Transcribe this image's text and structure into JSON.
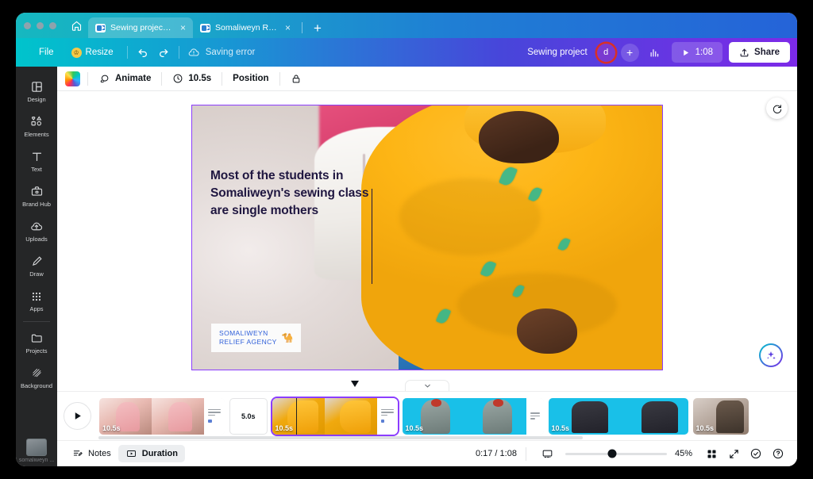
{
  "browser": {
    "home_icon": "home-icon",
    "tabs": [
      {
        "title": "Sewing project - Vi...",
        "favicon": "video-icon",
        "close": "×",
        "active": true
      },
      {
        "title": "Somaliweyn Relief ...",
        "favicon": "video-icon",
        "close": "×",
        "active": false
      }
    ],
    "new_tab_label": "+"
  },
  "toolbar": {
    "file_label": "File",
    "resize_label": "Resize",
    "crown_icon": "crown-icon",
    "undo_icon": "undo-icon",
    "redo_icon": "redo-icon",
    "saving_status": "Saving error",
    "cloud_alert_icon": "cloud-alert-icon",
    "project_name": "Sewing project",
    "avatar_initial": "d",
    "add_collaborator_label": "+",
    "insights_icon": "bar-chart-icon",
    "play_icon": "play-icon",
    "duration": "1:08",
    "share_label": "Share",
    "share_icon": "upload-icon"
  },
  "sidebar": {
    "items": [
      {
        "label": "Design",
        "icon": "layout-icon"
      },
      {
        "label": "Elements",
        "icon": "shapes-icon"
      },
      {
        "label": "Text",
        "icon": "text-icon"
      },
      {
        "label": "Brand Hub",
        "icon": "briefcase-icon"
      },
      {
        "label": "Uploads",
        "icon": "upload-cloud-icon"
      },
      {
        "label": "Draw",
        "icon": "pen-icon"
      },
      {
        "label": "Apps",
        "icon": "grid-dots-icon"
      }
    ],
    "bottom_items": [
      {
        "label": "Projects",
        "icon": "folder-icon"
      },
      {
        "label": "Background",
        "icon": "hatch-icon"
      }
    ],
    "thumbnail_label": "somaliweyn ..."
  },
  "context_toolbar": {
    "color_swatch": "rainbow-swatch",
    "animate_label": "Animate",
    "animate_icon": "animate-icon",
    "duration_value": "10.5s",
    "clock_icon": "clock-icon",
    "position_label": "Position",
    "lock_icon": "lock-icon"
  },
  "canvas": {
    "headline": "Most of the students in Somaliweyn's sewing class are single mothers",
    "logo": {
      "line1": "SOMALIWEYN",
      "line2": "RELIEF AGENCY",
      "icon": "camel-icon",
      "text_color": "#2f5fd9"
    },
    "rotate_icon": "rotate-add-icon",
    "ai_icon": "magic-sparkle-icon",
    "selection_color": "#8b3dff"
  },
  "timeline": {
    "play_icon": "play-icon",
    "collapse_icon": "chevron-down-icon",
    "playhead_icon": "playhead-marker",
    "clips": [
      {
        "duration": "10.5s",
        "art": "art-pink",
        "selected": false,
        "blank": false
      },
      {
        "duration": "5.0s",
        "art": "blank",
        "selected": false,
        "blank": true
      },
      {
        "duration": "10.5s",
        "art": "art-orange",
        "selected": true,
        "blank": false
      },
      {
        "duration": "10.5s",
        "art": "art-cyan",
        "selected": false,
        "blank": false
      },
      {
        "duration": "10.5s",
        "art": "art-class",
        "selected": false,
        "blank": false
      },
      {
        "duration": "10.5s",
        "art": "art-dark",
        "selected": false,
        "blank": false
      }
    ]
  },
  "statusbar": {
    "notes_label": "Notes",
    "notes_icon": "notes-icon",
    "duration_label": "Duration",
    "duration_icon": "duration-icon",
    "time_position": "0:17 / 1:08",
    "screen_icon": "present-icon",
    "zoom_level": "45%",
    "grid_icon": "grid-icon",
    "fullscreen_icon": "expand-icon",
    "check_icon": "check-circle-icon",
    "help_icon": "help-circle-icon"
  }
}
